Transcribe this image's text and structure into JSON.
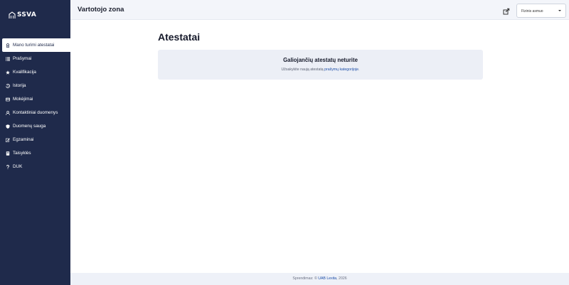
{
  "app": {
    "logo_text": "SSVA"
  },
  "header": {
    "title": "Vartotojo zona",
    "user_select_value": "Fizinis asmuo"
  },
  "sidebar": {
    "items": [
      {
        "label": "Mano turimi atestatai",
        "icon": "badge-icon",
        "active": true
      },
      {
        "label": "Prašymai",
        "icon": "list-icon"
      },
      {
        "label": "Kvalifikacija",
        "icon": "star-icon"
      },
      {
        "label": "Istorija",
        "icon": "history-icon"
      },
      {
        "label": "Mokėjimai",
        "icon": "card-icon"
      },
      {
        "label": "Kontaktiniai duomenys",
        "icon": "user-icon"
      },
      {
        "label": "Duomenų sauga",
        "icon": "shield-icon"
      },
      {
        "label": "Egzaminai",
        "icon": "edit-icon"
      },
      {
        "label": "Taisyklės",
        "icon": "book-icon"
      },
      {
        "label": "DUK",
        "icon": "question-icon"
      }
    ]
  },
  "main": {
    "title": "Atestatai",
    "notice": {
      "heading": "Galiojančių atestatų neturite",
      "text_before": "Užsakykite naują atestatą",
      "link_text": "prašymų kategorijoje",
      "text_after": "."
    }
  },
  "footer": {
    "prefix": "Sprendimas: ©",
    "company": "UAB Lexita",
    "year": ", 2026"
  },
  "colors": {
    "sidebar_bg": "#1f2a4b",
    "link": "#1c4ea8",
    "card_bg": "#eceff6"
  }
}
